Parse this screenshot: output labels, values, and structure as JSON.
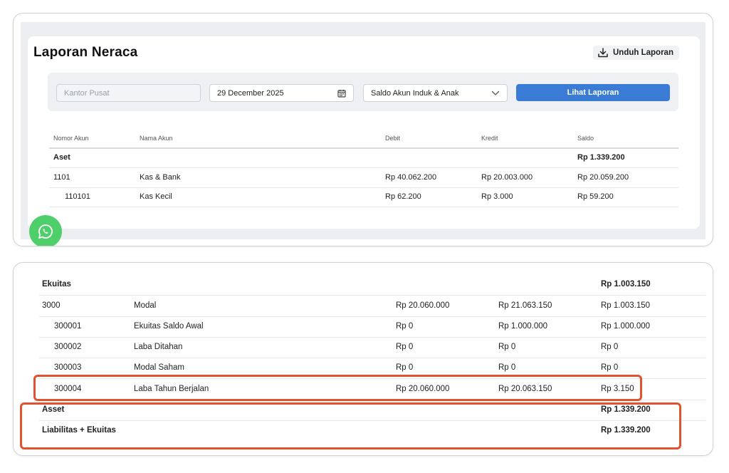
{
  "report": {
    "title": "Laporan Neraca",
    "download_label": "Unduh Laporan",
    "filters": {
      "branch_placeholder": "Kantor Pusat",
      "date_value": "29 December 2025",
      "mode_value": "Saldo Akun Induk & Anak",
      "submit_label": "Lihat Laporan"
    },
    "columns": [
      "Nomor Akun",
      "Nama Akun",
      "Debit",
      "Kredit",
      "Saldo"
    ],
    "rows": [
      {
        "code": "Aset",
        "name": "",
        "debit": "",
        "credit": "",
        "balance": "Rp 1.339.200"
      },
      {
        "code": "1101",
        "name": "Kas & Bank",
        "debit": "Rp 40.062.200",
        "credit": "Rp 20.003.000",
        "balance": "Rp 20.059.200"
      },
      {
        "code": "110101",
        "name": "Kas Kecil",
        "debit": "Rp 62.200",
        "credit": "Rp 3.000",
        "balance": "Rp 59.200"
      }
    ]
  },
  "equity": {
    "rows": [
      {
        "code": "Ekuitas",
        "name": "",
        "debit": "",
        "credit": "",
        "balance": "Rp 1.003.150"
      },
      {
        "code": "3000",
        "name": "Modal",
        "debit": "Rp 20.060.000",
        "credit": "Rp 21.063.150",
        "balance": "Rp 1.003.150"
      },
      {
        "code": "300001",
        "name": "Ekuitas Saldo Awal",
        "debit": "Rp 0",
        "credit": "Rp 1.000.000",
        "balance": "Rp 1.000.000"
      },
      {
        "code": "300002",
        "name": "Laba Ditahan",
        "debit": "Rp 0",
        "credit": "Rp 0",
        "balance": "Rp 0"
      },
      {
        "code": "300003",
        "name": "Modal Saham",
        "debit": "Rp 0",
        "credit": "Rp 0",
        "balance": "Rp 0"
      },
      {
        "code": "300004",
        "name": "Laba Tahun Berjalan",
        "debit": "Rp 20.060.000",
        "credit": "Rp 20.063.150",
        "balance": "Rp 3.150"
      },
      {
        "code": "Asset",
        "name": "",
        "debit": "",
        "credit": "",
        "balance": "Rp 1.339.200"
      },
      {
        "code": "Liabilitas + Ekuitas",
        "name": "",
        "debit": "",
        "credit": "",
        "balance": "Rp 1.339.200"
      }
    ]
  },
  "icons": {
    "download": "download-icon",
    "calendar": "calendar-icon",
    "chevron": "chevron-down-icon",
    "whatsapp": "whatsapp-icon"
  },
  "colors": {
    "accent": "#3a7bd5",
    "highlight": "#e0532f",
    "whatsapp": "#4fcf6a"
  }
}
